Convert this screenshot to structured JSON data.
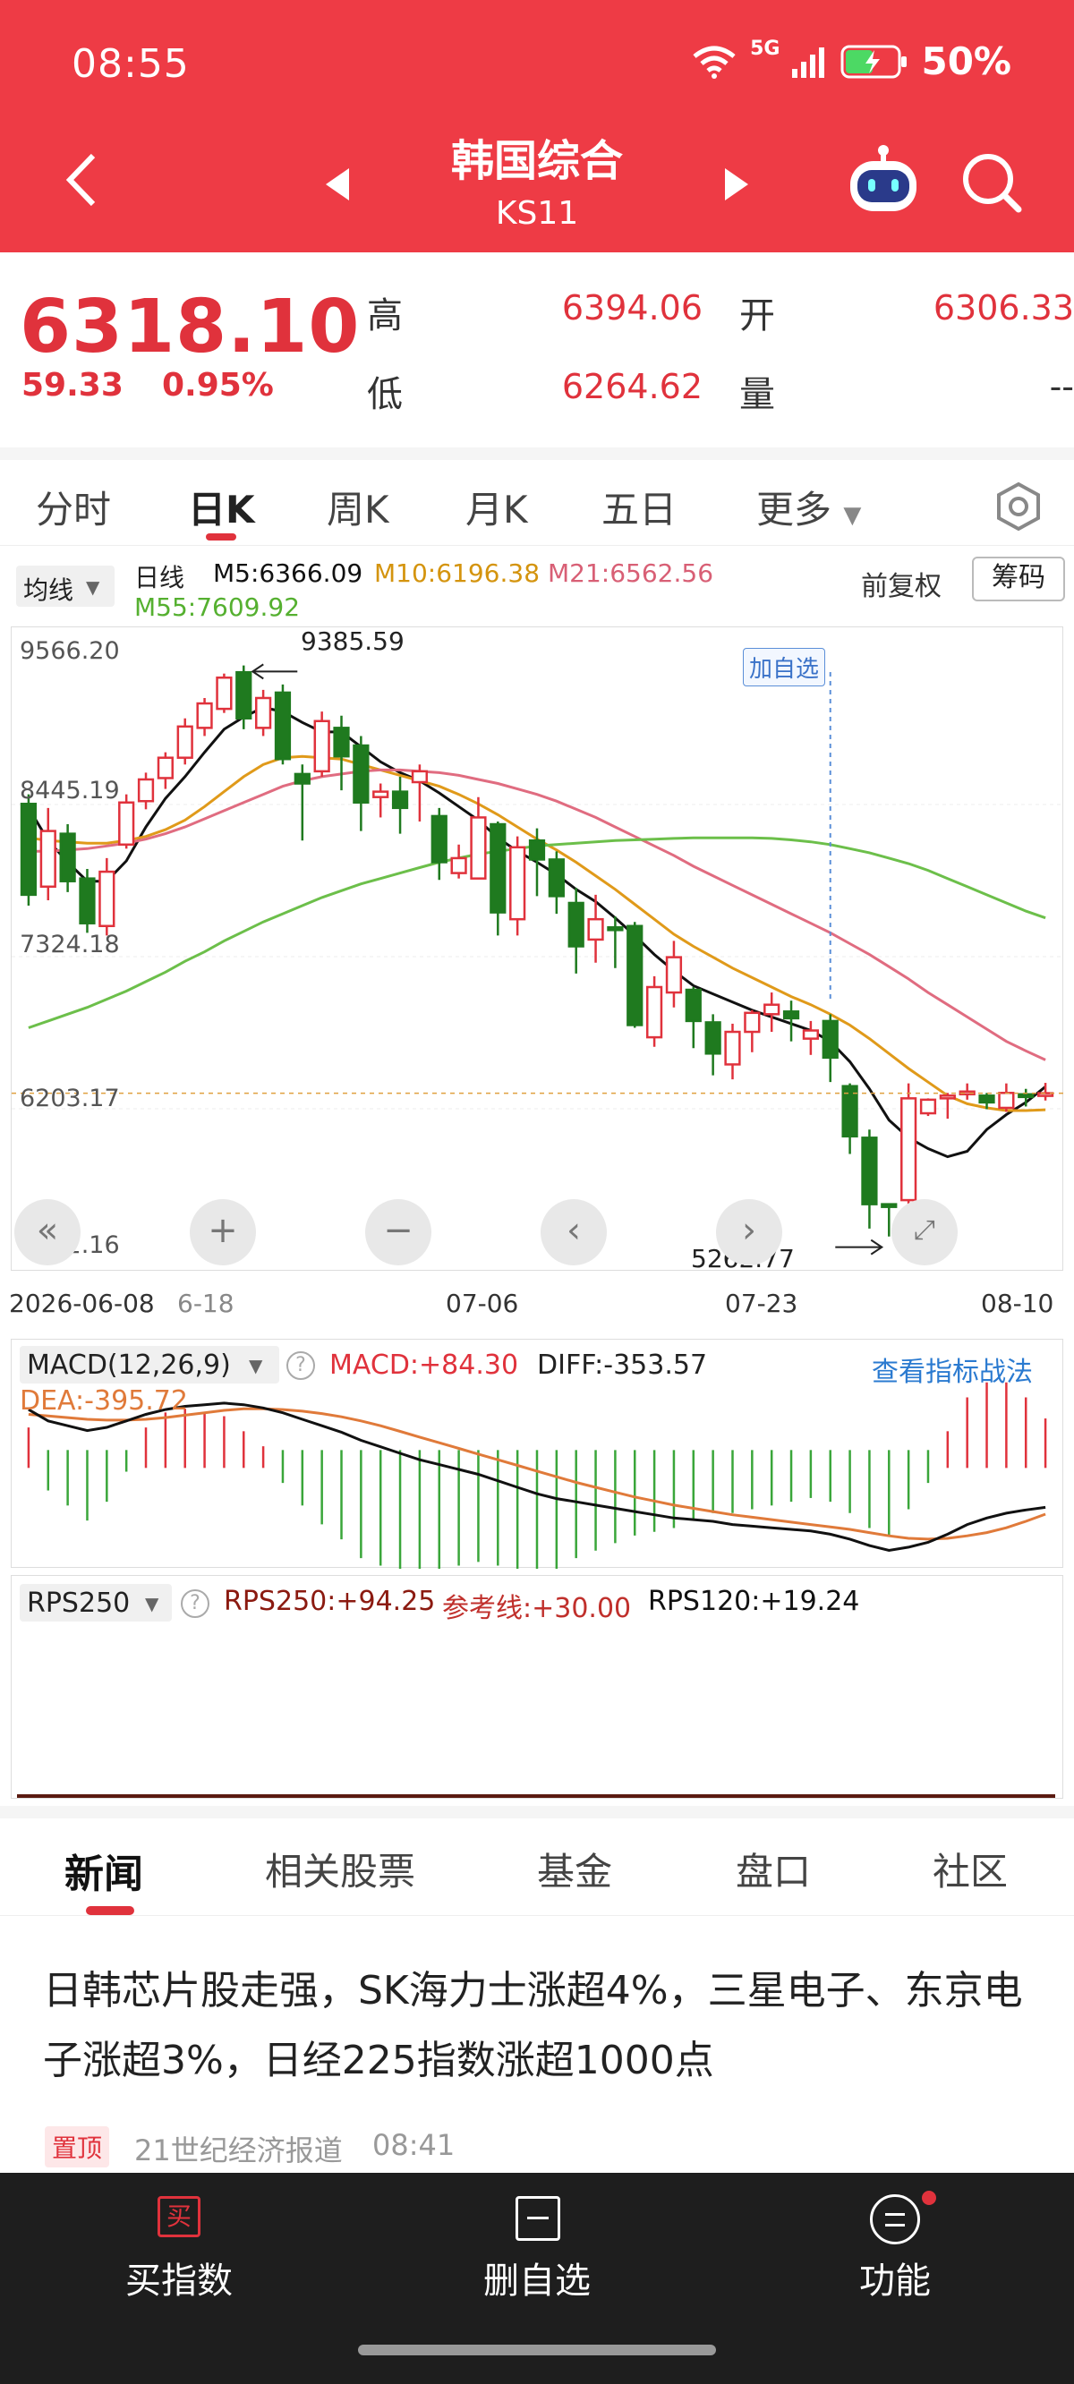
{
  "status": {
    "time": "08:55",
    "battery": "50%",
    "network": "5G"
  },
  "header": {
    "title": "韩国综合",
    "code": "KS11"
  },
  "quote": {
    "price": "6318.10",
    "change": "59.33",
    "change_pct": "0.95%",
    "high_label": "高",
    "high": "6394.06",
    "low_label": "低",
    "low": "6264.62",
    "open_label": "开",
    "open": "6306.33",
    "volume_label": "量",
    "volume": "--"
  },
  "period_tabs": [
    "分时",
    "日K",
    "周K",
    "月K",
    "五日",
    "更多"
  ],
  "active_period": "日K",
  "legend": {
    "ma_select": "均线",
    "period": "日线",
    "m5": "M5:6366.09",
    "m10": "M10:6196.38",
    "m21": "M21:6562.56",
    "m55": "M55:7609.92",
    "adjust": "前复权",
    "chip_button": "筹码"
  },
  "chart_annotations": {
    "high_marker": "9385.59",
    "low_marker": "5262.77",
    "add_watch": "加自选"
  },
  "macd_panel": {
    "selector": "MACD(12,26,9)",
    "macd": "MACD:+84.30",
    "diff": "DIFF:-353.57",
    "dea": "DEA:-395.72",
    "strategy_link": "查看指标战法"
  },
  "rps_panel": {
    "selector": "RPS250",
    "rps250": "RPS250:+94.25",
    "ref": "参考线:+30.00",
    "rps120": "RPS120:+19.24"
  },
  "news_tabs": [
    "新闻",
    "相关股票",
    "基金",
    "盘口",
    "社区"
  ],
  "news": {
    "headline": "日韩芯片股走强，SK海力士涨超4%，三星电子、东京电子涨超3%，日经225指数涨超1000点",
    "pin": "置顶",
    "source": "21世纪经济报道",
    "time": "08:41"
  },
  "bottom_bar": {
    "buy": "买指数",
    "remove": "删自选",
    "func": "功能"
  },
  "colors": {
    "up": "#e0323c",
    "down": "#1f7a1f",
    "header": "#ee3b45",
    "m5": "#111111",
    "m10": "#e09a1a",
    "m21": "#e06c80",
    "m55": "#6cbf4a"
  },
  "chart_data": {
    "type": "candlestick",
    "x_tick_labels": [
      "2026-06-08",
      "6-18",
      "07-06",
      "07-23",
      "08-10"
    ],
    "y_tick_labels": [
      "9566.20",
      "8445.19",
      "7324.18",
      "6203.17",
      "5082.16"
    ],
    "ylim": [
      5082.16,
      9566.2
    ],
    "grid": true,
    "candles": [
      [
        8450,
        7780,
        7700,
        8520
      ],
      [
        7840,
        8250,
        7740,
        8420
      ],
      [
        8230,
        7880,
        7800,
        8300
      ],
      [
        7900,
        7570,
        7500,
        7970
      ],
      [
        7550,
        7950,
        7480,
        8050
      ],
      [
        8150,
        8460,
        8120,
        8520
      ],
      [
        8470,
        8630,
        8410,
        8680
      ],
      [
        8640,
        8790,
        8560,
        8830
      ],
      [
        8790,
        9020,
        8740,
        9080
      ],
      [
        9010,
        9190,
        8950,
        9230
      ],
      [
        9150,
        9380,
        9120,
        9410
      ],
      [
        9420,
        9080,
        9000,
        9470
      ],
      [
        9010,
        9230,
        8950,
        9290
      ],
      [
        9270,
        8780,
        8740,
        9330
      ],
      [
        8670,
        8600,
        8180,
        8740
      ],
      [
        8690,
        9060,
        8650,
        9130
      ],
      [
        9010,
        8800,
        8550,
        9100
      ],
      [
        8880,
        8460,
        8250,
        8950
      ],
      [
        8500,
        8540,
        8350,
        8600
      ],
      [
        8540,
        8420,
        8230,
        8650
      ],
      [
        8610,
        8690,
        8320,
        8740
      ],
      [
        8360,
        8020,
        7890,
        8420
      ],
      [
        7940,
        8050,
        7900,
        8150
      ],
      [
        7900,
        8350,
        7900,
        8500
      ],
      [
        8300,
        7650,
        7480,
        8320
      ],
      [
        7600,
        8130,
        7480,
        8210
      ],
      [
        8180,
        8040,
        7770,
        8270
      ],
      [
        8040,
        7770,
        7640,
        8100
      ],
      [
        7720,
        7400,
        7200,
        7830
      ],
      [
        7450,
        7600,
        7280,
        7780
      ],
      [
        7540,
        7520,
        7240,
        7620
      ],
      [
        7550,
        6820,
        6800,
        7580
      ],
      [
        6730,
        7100,
        6660,
        7180
      ],
      [
        7060,
        7320,
        6950,
        7440
      ],
      [
        7080,
        6850,
        6650,
        7100
      ],
      [
        6840,
        6610,
        6450,
        6900
      ],
      [
        6530,
        6770,
        6420,
        6830
      ],
      [
        6770,
        6910,
        6620,
        6930
      ],
      [
        6900,
        6970,
        6770,
        7060
      ],
      [
        6920,
        6870,
        6700,
        7000
      ],
      [
        6720,
        6780,
        6600,
        6850
      ],
      [
        6850,
        6580,
        6400,
        6900
      ],
      [
        6370,
        6000,
        5870,
        6390
      ],
      [
        5990,
        5500,
        5320,
        6050
      ],
      [
        5500,
        5480,
        5262,
        5500
      ],
      [
        5530,
        6280,
        5490,
        6390
      ],
      [
        6170,
        6270,
        6150,
        6280
      ],
      [
        6280,
        6300,
        6130,
        6320
      ],
      [
        6320,
        6330,
        6270,
        6390
      ],
      [
        6300,
        6250,
        6200,
        6320
      ],
      [
        6210,
        6320,
        6180,
        6390
      ],
      [
        6310,
        6290,
        6220,
        6350
      ],
      [
        6310,
        6318,
        6264,
        6394
      ]
    ],
    "candle_format": "open,close,low,high",
    "series": [
      {
        "name": "M5",
        "values": [
          8420,
          8180,
          8020,
          7880,
          7880,
          8030,
          8280,
          8490,
          8650,
          8830,
          9000,
          9090,
          9160,
          9130,
          9050,
          8980,
          8980,
          8870,
          8760,
          8680,
          8620,
          8530,
          8430,
          8330,
          8200,
          8100,
          8020,
          7930,
          7820,
          7730,
          7610,
          7480,
          7340,
          7220,
          7110,
          7050,
          6990,
          6930,
          6880,
          6830,
          6780,
          6700,
          6550,
          6350,
          6120,
          5990,
          5910,
          5850,
          5890,
          6050,
          6160,
          6250,
          6366
        ]
      },
      {
        "name": "M10",
        "values": [
          8200,
          8180,
          8170,
          8160,
          8160,
          8180,
          8210,
          8260,
          8330,
          8430,
          8540,
          8650,
          8740,
          8790,
          8800,
          8790,
          8780,
          8740,
          8700,
          8660,
          8620,
          8580,
          8520,
          8450,
          8370,
          8280,
          8190,
          8110,
          8020,
          7920,
          7820,
          7710,
          7600,
          7490,
          7400,
          7320,
          7240,
          7170,
          7100,
          7030,
          6970,
          6900,
          6820,
          6720,
          6610,
          6500,
          6400,
          6300,
          6240,
          6210,
          6190,
          6190,
          6196
        ]
      },
      {
        "name": "M21",
        "values": [
          8100,
          8100,
          8110,
          8120,
          8140,
          8160,
          8190,
          8230,
          8280,
          8340,
          8400,
          8460,
          8520,
          8580,
          8620,
          8650,
          8670,
          8690,
          8700,
          8700,
          8690,
          8680,
          8660,
          8630,
          8600,
          8560,
          8520,
          8470,
          8410,
          8350,
          8280,
          8210,
          8140,
          8070,
          7990,
          7920,
          7850,
          7780,
          7710,
          7640,
          7570,
          7500,
          7420,
          7340,
          7250,
          7160,
          7060,
          6970,
          6880,
          6790,
          6700,
          6630,
          6563
        ]
      },
      {
        "name": "M55",
        "values": [
          6800,
          6850,
          6900,
          6950,
          7010,
          7070,
          7140,
          7210,
          7290,
          7360,
          7440,
          7510,
          7580,
          7640,
          7700,
          7760,
          7810,
          7860,
          7900,
          7940,
          7980,
          8020,
          8050,
          8080,
          8100,
          8120,
          8140,
          8150,
          8160,
          8170,
          8180,
          8185,
          8190,
          8195,
          8200,
          8200,
          8200,
          8200,
          8195,
          8185,
          8170,
          8150,
          8120,
          8090,
          8050,
          8010,
          7960,
          7900,
          7840,
          7780,
          7720,
          7660,
          7610
        ]
      }
    ],
    "macd": {
      "diff": [
        250,
        180,
        150,
        120,
        140,
        180,
        220,
        250,
        270,
        280,
        290,
        280,
        260,
        230,
        190,
        150,
        110,
        60,
        20,
        -20,
        -60,
        -90,
        -120,
        -150,
        -190,
        -230,
        -270,
        -300,
        -320,
        -340,
        -360,
        -380,
        -400,
        -420,
        -430,
        -440,
        -460,
        -470,
        -480,
        -490,
        -500,
        -520,
        -550,
        -590,
        -620,
        -600,
        -570,
        -520,
        -460,
        -420,
        -390,
        -370,
        -354
      ],
      "dea": [
        220,
        210,
        200,
        190,
        185,
        185,
        190,
        200,
        215,
        230,
        245,
        255,
        255,
        250,
        240,
        225,
        205,
        180,
        150,
        115,
        80,
        45,
        10,
        -25,
        -60,
        -95,
        -130,
        -165,
        -200,
        -230,
        -260,
        -290,
        -315,
        -340,
        -360,
        -380,
        -400,
        -415,
        -430,
        -445,
        -460,
        -475,
        -490,
        -510,
        -530,
        -545,
        -550,
        -545,
        -530,
        -510,
        -480,
        -440,
        -396
      ]
    },
    "rps": {
      "rps250": 94.25,
      "reference": 30.0,
      "rps120": 19.24
    }
  }
}
